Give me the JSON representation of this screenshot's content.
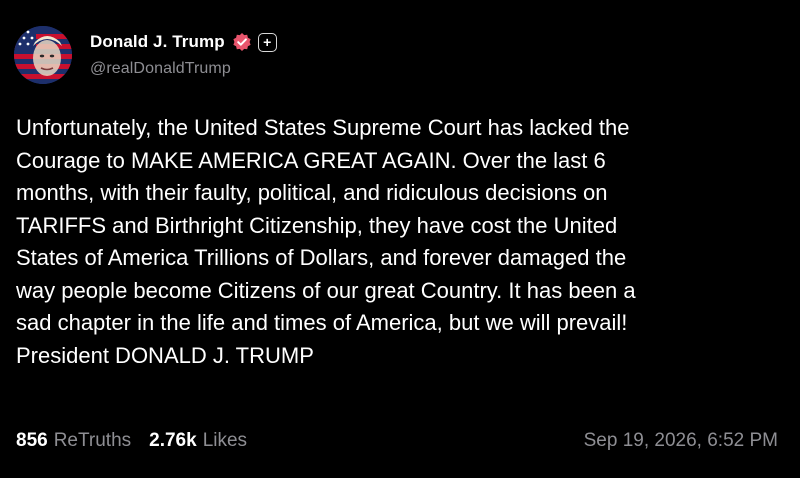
{
  "author": {
    "display_name": "Donald J. Trump",
    "handle": "@realDonaldTrump",
    "avatar_icon": "avatar-flag-portrait",
    "verified_icon": "verified-badge-icon",
    "plus_icon": "plus-badge-icon",
    "plus_symbol": "+"
  },
  "post": {
    "text": "Unfortunately, the United States Supreme Court has lacked the\nCourage to MAKE AMERICA GREAT AGAIN. Over the last 6\nmonths, with their faulty, political, and ridiculous decisions on\nTARIFFS and Birthright Citizenship, they have cost the United\nStates of America Trillions of Dollars, and forever damaged the\nway people become Citizens of our great Country. It has been a\nsad chapter in the life and times of America, but we will prevail!\nPresident DONALD J. TRUMP"
  },
  "stats": {
    "retruths_count": "856",
    "retruths_label": "ReTruths",
    "likes_count": "2.76k",
    "likes_label": "Likes",
    "timestamp": "Sep 19, 2026, 6:52 PM"
  },
  "colors": {
    "background": "#000000",
    "text": "#ffffff",
    "muted": "#8e8e93",
    "verified": "#e8556d"
  }
}
